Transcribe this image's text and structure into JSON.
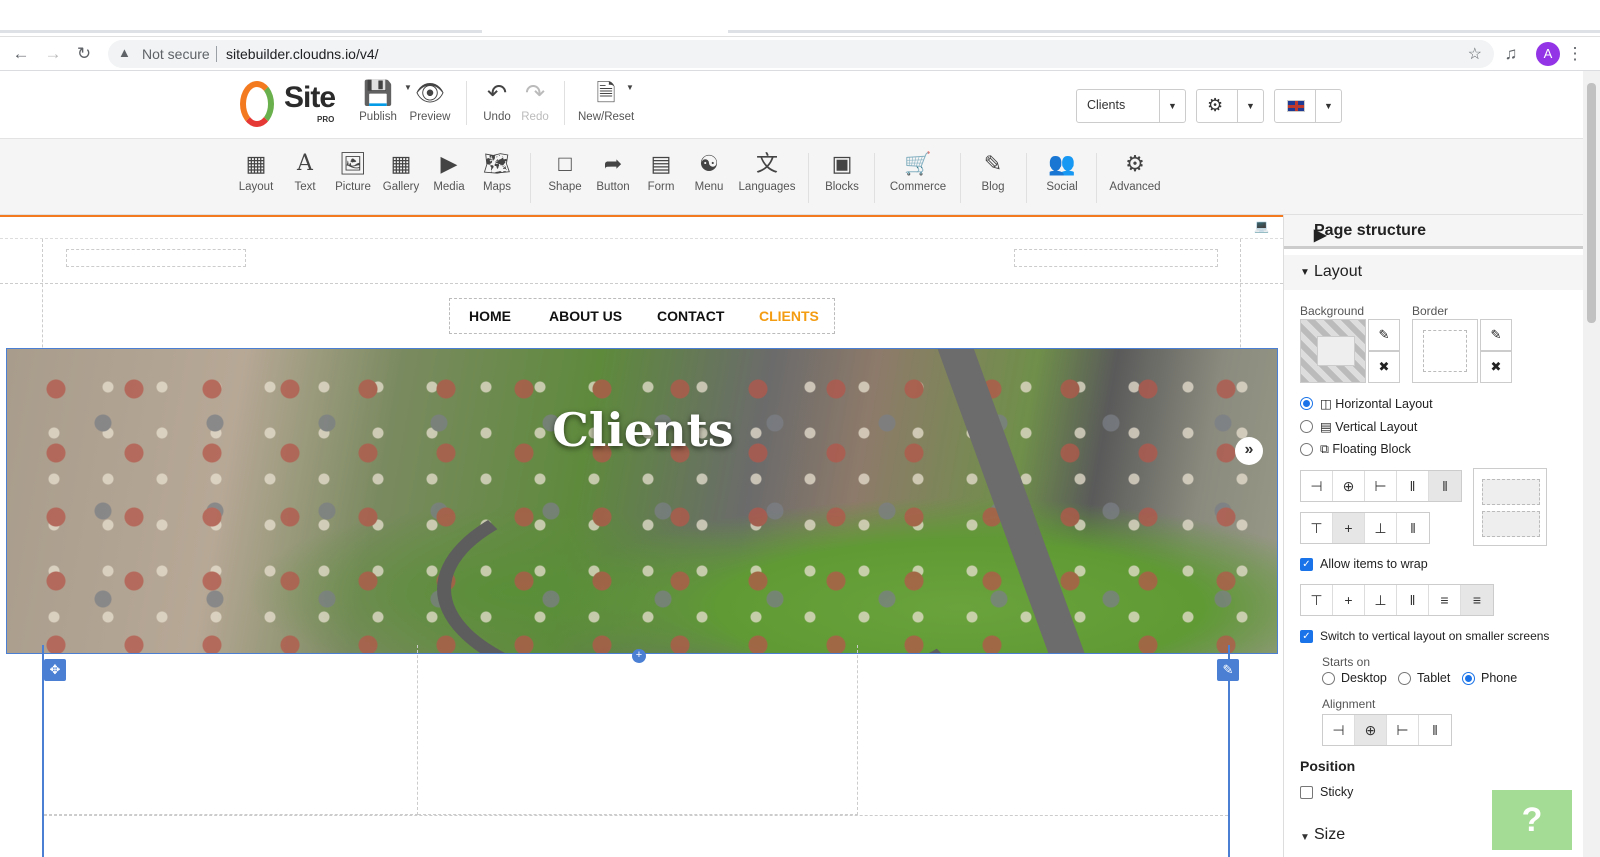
{
  "browser": {
    "security_label": "Not secure",
    "url": "sitebuilder.cloudns.io/v4/",
    "avatar_letter": "A"
  },
  "header": {
    "logo_text": "Site",
    "logo_sub": "PRO",
    "publish": "Publish",
    "preview": "Preview",
    "undo": "Undo",
    "redo": "Redo",
    "new_reset": "New/Reset",
    "page_select": "Clients"
  },
  "toolbar": {
    "items": [
      "Layout",
      "Text",
      "Picture",
      "Gallery",
      "Media",
      "Maps",
      "Shape",
      "Button",
      "Form",
      "Menu",
      "Languages",
      "Blocks",
      "Commerce",
      "Blog",
      "Social",
      "Advanced"
    ]
  },
  "site": {
    "menu": [
      "HOME",
      "ABOUT US",
      "CONTACT",
      "CLIENTS"
    ],
    "hero_title": "Clients",
    "active_color": "#f39c12"
  },
  "panel": {
    "page_structure": "Page structure",
    "layout": "Layout",
    "background": "Background",
    "border": "Border",
    "layout_options": [
      "Horizontal Layout",
      "Vertical Layout",
      "Floating Block"
    ],
    "allow_wrap": "Allow items to wrap",
    "switch_vertical": "Switch to vertical layout on smaller screens",
    "starts_on": "Starts on",
    "starts_options": [
      "Desktop",
      "Tablet",
      "Phone"
    ],
    "alignment": "Alignment",
    "position": "Position",
    "sticky": "Sticky",
    "size": "Size"
  },
  "help_label": "?"
}
